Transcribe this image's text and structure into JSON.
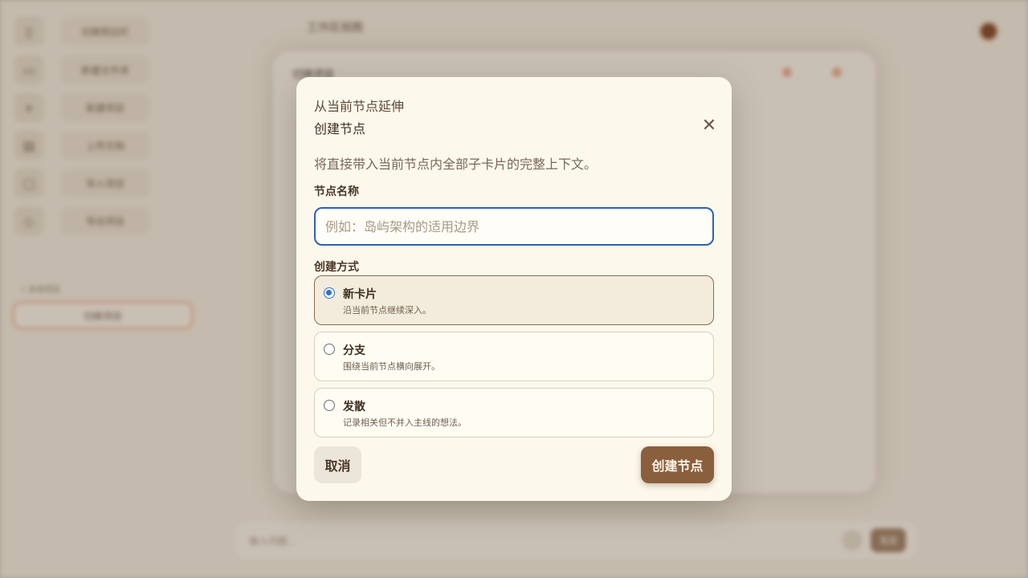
{
  "background": {
    "sidebar": [
      {
        "icon": "sidebar-toggle-icon",
        "glyph": "▯",
        "label": "切换侧边栏"
      },
      {
        "icon": "new-folder-icon",
        "glyph": "▭",
        "label": "新建文件夹"
      },
      {
        "icon": "plus-icon",
        "glyph": "+",
        "label": "新建项目"
      },
      {
        "icon": "file-icon",
        "glyph": "▤",
        "label": "上传文档"
      },
      {
        "icon": "import-icon",
        "glyph": "▢",
        "label": "导入项目"
      },
      {
        "icon": "export-icon",
        "glyph": "◇",
        "label": "导出项目"
      }
    ],
    "project_section_title": "• 本地项目",
    "active_project": "切换项目",
    "workspace_title": "工作区视图",
    "panel_title": "切换项目",
    "chat_placeholder": "输入问题...",
    "chat_send": "发送"
  },
  "modal": {
    "eyebrow": "从当前节点延伸",
    "title": "创建节点",
    "close_glyph": "✕",
    "description": "将直接带入当前节点内全部子卡片的完整上下文。",
    "name_label": "节点名称",
    "name_placeholder": "例如：岛屿架构的适用边界",
    "name_value": "",
    "mode_label": "创建方式",
    "options": [
      {
        "title": "新卡片",
        "subtitle": "沿当前节点继续深入。",
        "selected": true
      },
      {
        "title": "分支",
        "subtitle": "围绕当前节点横向展开。",
        "selected": false
      },
      {
        "title": "发散",
        "subtitle": "记录相关但不并入主线的想法。",
        "selected": false
      }
    ],
    "cancel_label": "取消",
    "create_label": "创建节点"
  },
  "colors": {
    "accent": "#8a5f3e",
    "focus_ring": "#2f5fb8",
    "radio_checked": "#2f6fd6",
    "modal_bg": "#fdf8ec"
  }
}
